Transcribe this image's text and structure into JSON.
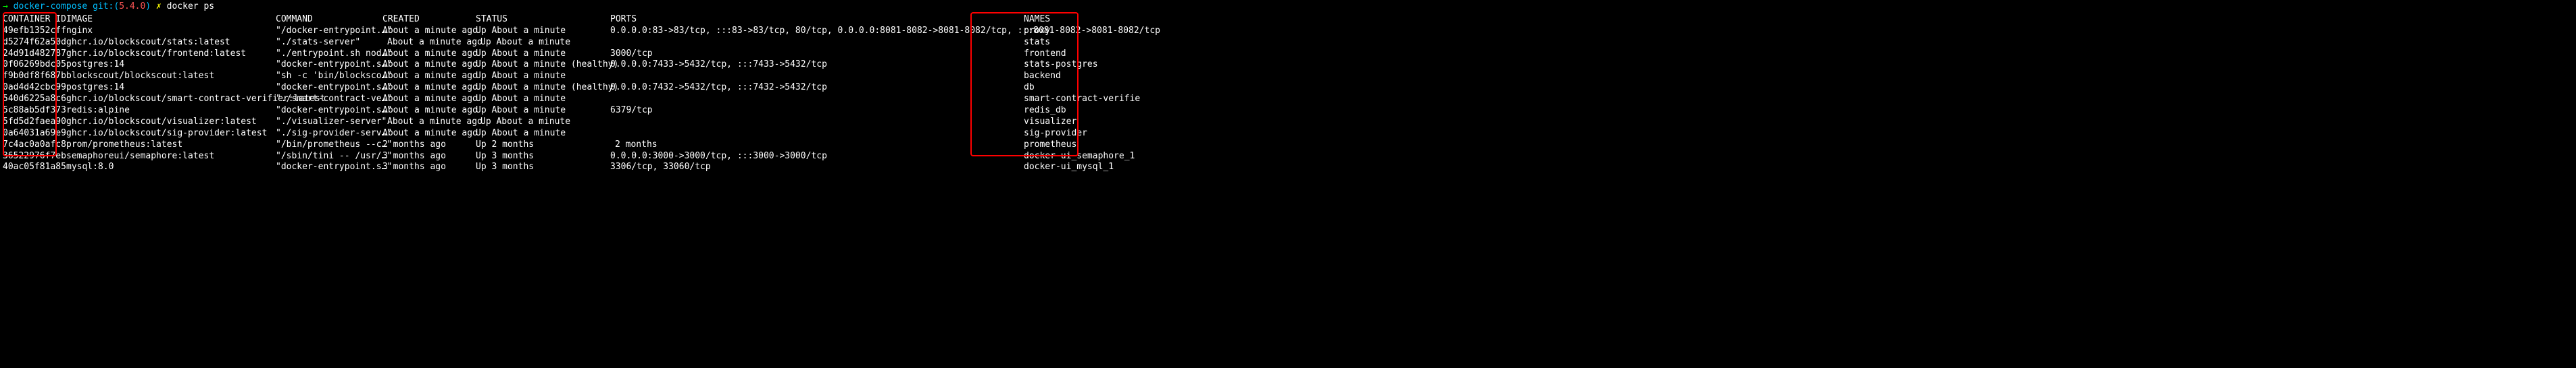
{
  "prompt": {
    "arrow": "→",
    "dir": "docker-compose",
    "git_label": "git:(",
    "branch": "5.4.0",
    "git_close": ")",
    "dirty": "✗",
    "command": "docker ps"
  },
  "headers": {
    "id": "CONTAINER ID",
    "image": "IMAGE",
    "command": "COMMAND",
    "created": "CREATED",
    "status": "STATUS",
    "ports": "PORTS",
    "names": "NAMES"
  },
  "rows": [
    {
      "id": "49efb1352cff",
      "image": "nginx",
      "command": "\"/docker-entrypoint.…\"",
      "created": "About a minute ago",
      "created_indent": false,
      "status": "Up About a minute",
      "status_indent": false,
      "ports": "0.0.0.0:83->83/tcp, :::83->83/tcp, 80/tcp, 0.0.0.0:8081-8082->8081-8082/tcp, :::8081-8082->8081-8082/tcp",
      "ports_indent": false,
      "names": "proxy"
    },
    {
      "id": "d5274f62a50d",
      "image": "ghcr.io/blockscout/stats:latest",
      "command": "\"./stats-server\"",
      "created": "About a minute ago",
      "created_indent": true,
      "status": "Up About a minute",
      "status_indent": true,
      "ports": "",
      "ports_indent": false,
      "names": "stats"
    },
    {
      "id": "24d91d482787",
      "image": "ghcr.io/blockscout/frontend:latest",
      "command": "\"./entrypoint.sh nod…\"",
      "created": "About a minute ago",
      "created_indent": false,
      "status": "Up About a minute",
      "status_indent": false,
      "ports": "3000/tcp",
      "ports_indent": false,
      "names": "frontend"
    },
    {
      "id": "0f06269bdc05",
      "image": "postgres:14",
      "command": "\"docker-entrypoint.s…\"",
      "created": "About a minute ago",
      "created_indent": false,
      "status": "Up About a minute (healthy)",
      "status_indent": false,
      "ports": "0.0.0.0:7433->5432/tcp, :::7433->5432/tcp",
      "ports_indent": false,
      "names": "stats-postgres"
    },
    {
      "id": "f9b0df8f687b",
      "image": "blockscout/blockscout:latest",
      "command": "\"sh -c 'bin/blocksco…\"",
      "created": "About a minute ago",
      "created_indent": false,
      "status": "Up About a minute",
      "status_indent": false,
      "ports": "",
      "ports_indent": false,
      "names": "backend"
    },
    {
      "id": "0ad4d42cbc99",
      "image": "postgres:14",
      "command": "\"docker-entrypoint.s…\"",
      "created": "About a minute ago",
      "created_indent": false,
      "status": "Up About a minute (healthy)",
      "status_indent": false,
      "ports": "0.0.0.0:7432->5432/tcp, :::7432->5432/tcp",
      "ports_indent": false,
      "names": "db"
    },
    {
      "id": "540d6225a8c6",
      "image": "ghcr.io/blockscout/smart-contract-verifier:latest",
      "command": "\"./smart-contract-ve…\"",
      "created": "About a minute ago",
      "created_indent": false,
      "status": "Up About a minute",
      "status_indent": false,
      "ports": "",
      "ports_indent": false,
      "names": "smart-contract-verifie"
    },
    {
      "id": "",
      "image": "",
      "command": "",
      "created": "",
      "created_indent": false,
      "status": "",
      "status_indent": false,
      "ports": "",
      "ports_indent": false,
      "names": ""
    },
    {
      "id": "5c88ab5df373",
      "image": "redis:alpine",
      "command": "\"docker-entrypoint.s…\"",
      "created": "About a minute ago",
      "created_indent": false,
      "status": "Up About a minute",
      "status_indent": false,
      "ports": "6379/tcp",
      "ports_indent": false,
      "names": "redis_db"
    },
    {
      "id": "5fd5d2faea90",
      "image": "ghcr.io/blockscout/visualizer:latest",
      "command": "\"./visualizer-server\"",
      "created": "About a minute ago",
      "created_indent": true,
      "status": "Up About a minute",
      "status_indent": true,
      "ports": "",
      "ports_indent": false,
      "names": "visualizer"
    },
    {
      "id": "0a64031a69e9",
      "image": "ghcr.io/blockscout/sig-provider:latest",
      "command": "\"./sig-provider-serv…\"",
      "created": "About a minute ago",
      "created_indent": false,
      "status": "Up About a minute",
      "status_indent": false,
      "ports": "",
      "ports_indent": false,
      "names": "sig-provider"
    },
    {
      "id": "7c4ac0a0afc8",
      "image": "prom/prometheus:latest",
      "command": "\"/bin/prometheus --c…\"",
      "created": "2 months ago",
      "created_indent": false,
      "status": "Up 2 months",
      "status_indent": false,
      "ports": "2 months",
      "ports_indent": true,
      "names": "prometheus"
    },
    {
      "id": "36522976f7eb",
      "image": "semaphoreui/semaphore:latest",
      "command": "\"/sbin/tini -- /usr/…\"",
      "created": "3 months ago",
      "created_indent": false,
      "status": "Up 3 months",
      "status_indent": false,
      "ports": "0.0.0.0:3000->3000/tcp, :::3000->3000/tcp",
      "ports_indent": false,
      "names": "docker-ui_semaphore_1"
    },
    {
      "id": "40ac05f81a85",
      "image": "mysql:8.0",
      "command": "\"docker-entrypoint.s…\"",
      "created": "3 months ago",
      "created_indent": false,
      "status": "Up 3 months",
      "status_indent": false,
      "ports": "3306/tcp, 33060/tcp",
      "ports_indent": false,
      "names": "docker-ui_mysql_1"
    }
  ]
}
